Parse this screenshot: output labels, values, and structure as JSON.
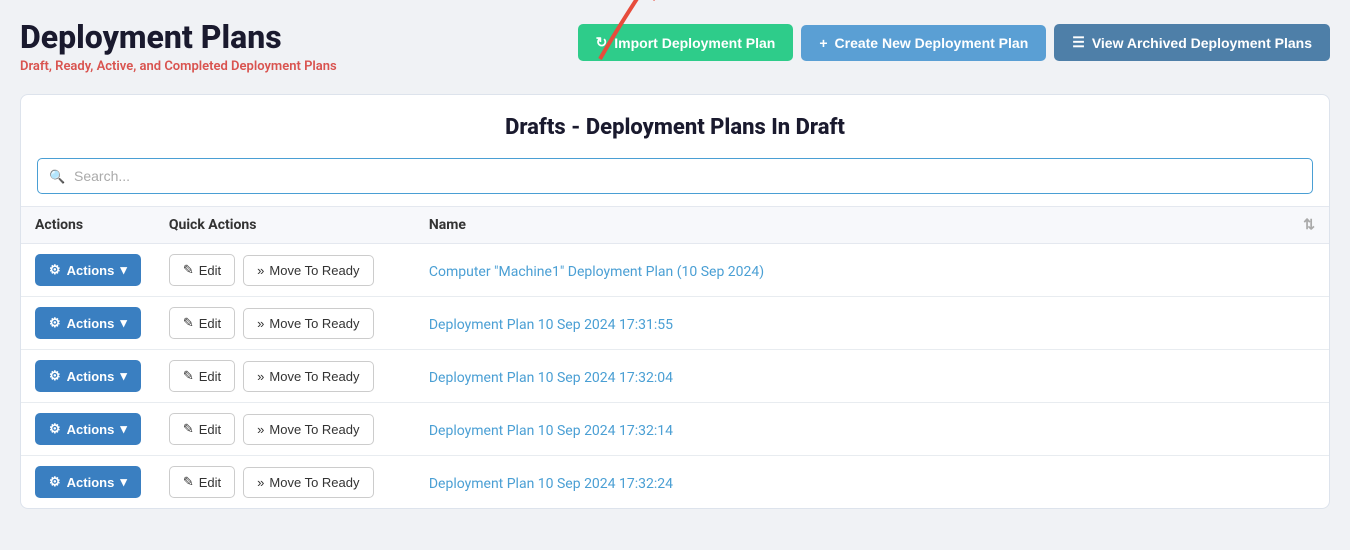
{
  "page": {
    "title": "Deployment Plans",
    "subtitle_prefix": "Draft, Ready, Active, and ",
    "subtitle_highlight": "Completed",
    "subtitle_suffix": " Deployment Plans"
  },
  "header": {
    "import_btn": "Import Deployment Plan",
    "create_btn": "Create New Deployment Plan",
    "archive_btn": "View Archived Deployment Plans"
  },
  "section": {
    "title": "Drafts - Deployment Plans In Draft"
  },
  "search": {
    "placeholder": "Search..."
  },
  "table": {
    "col_actions": "Actions",
    "col_quick_actions": "Quick Actions",
    "col_name": "Name",
    "actions_label": "Actions",
    "edit_label": "Edit",
    "move_label": "Move To Ready",
    "rows": [
      {
        "name": "Computer \"Machine1\" Deployment Plan (10 Sep 2024)"
      },
      {
        "name": "Deployment Plan 10 Sep 2024 17:31:55"
      },
      {
        "name": "Deployment Plan 10 Sep 2024 17:32:04"
      },
      {
        "name": "Deployment Plan 10 Sep 2024 17:32:14"
      },
      {
        "name": "Deployment Plan 10 Sep 2024 17:32:24"
      }
    ]
  }
}
